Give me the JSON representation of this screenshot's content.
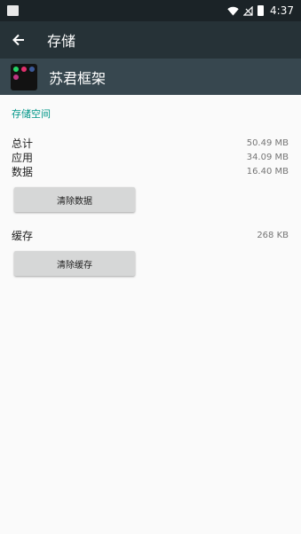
{
  "status_bar": {
    "time": "4:37"
  },
  "app_bar": {
    "title": "存储"
  },
  "app_header": {
    "name": "苏君框架"
  },
  "storage": {
    "section_title": "存储空间",
    "rows": [
      {
        "label": "总计",
        "value": "50.49 MB"
      },
      {
        "label": "应用",
        "value": "34.09 MB"
      },
      {
        "label": "数据",
        "value": "16.40 MB"
      }
    ],
    "clear_data_label": "清除数据"
  },
  "cache": {
    "label": "缓存",
    "value": "268 KB",
    "clear_cache_label": "清除缓存"
  },
  "colors": {
    "status_bar": "#1b2327",
    "app_bar": "#263237",
    "app_header": "#37474f",
    "accent": "#009688"
  }
}
